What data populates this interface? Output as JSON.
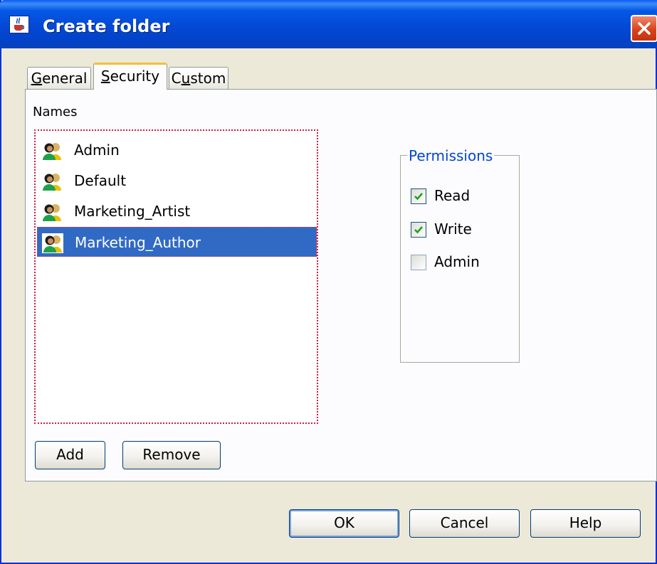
{
  "window": {
    "title": "Create folder",
    "app_icon": "java-cup-icon",
    "close_icon": "close-icon"
  },
  "tabs": [
    {
      "label": "General",
      "mnemonic_index": 0,
      "selected": false
    },
    {
      "label": "Security",
      "mnemonic_index": 0,
      "selected": true
    },
    {
      "label": "Custom",
      "mnemonic_index": 1,
      "selected": false
    }
  ],
  "security": {
    "names_label": "Names",
    "names": [
      {
        "label": "Admin",
        "icon": "user-group-icon",
        "selected": false
      },
      {
        "label": "Default",
        "icon": "user-group-icon",
        "selected": false
      },
      {
        "label": "Marketing_Artist",
        "icon": "user-group-icon",
        "selected": false
      },
      {
        "label": "Marketing_Author",
        "icon": "user-group-icon",
        "selected": true
      }
    ],
    "add_label": "Add",
    "remove_label": "Remove",
    "permissions": {
      "legend": "Permissions",
      "items": [
        {
          "label": "Read",
          "checked": true
        },
        {
          "label": "Write",
          "checked": true
        },
        {
          "label": "Admin",
          "checked": false
        }
      ]
    }
  },
  "footer": {
    "ok_label": "OK",
    "cancel_label": "Cancel",
    "help_label": "Help"
  },
  "colors": {
    "title_bar": "#0347d2",
    "dialog_bg": "#ece9d8",
    "selection": "#316ac5",
    "permissions_legend": "#0046d5",
    "checkmark": "#21a121",
    "active_tab_highlight": "#f4bf3a"
  }
}
